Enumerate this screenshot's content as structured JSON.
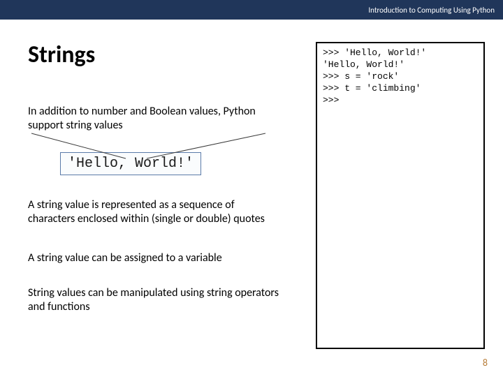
{
  "header": {
    "title": "Introduction to Computing Using Python"
  },
  "slide": {
    "title": "Strings",
    "para1": "In addition to number and Boolean values, Python support string values",
    "code_example": "'Hello, World!'",
    "para2": "A string value is represented as a sequence of characters enclosed within (single or double) quotes",
    "para3": "A string value can be assigned to a variable",
    "para4": "String values can be manipulated using string operators and functions",
    "shell": ">>> 'Hello, World!'\n'Hello, World!'\n>>> s = 'rock'\n>>> t = 'climbing'\n>>>",
    "page_number": "8"
  }
}
